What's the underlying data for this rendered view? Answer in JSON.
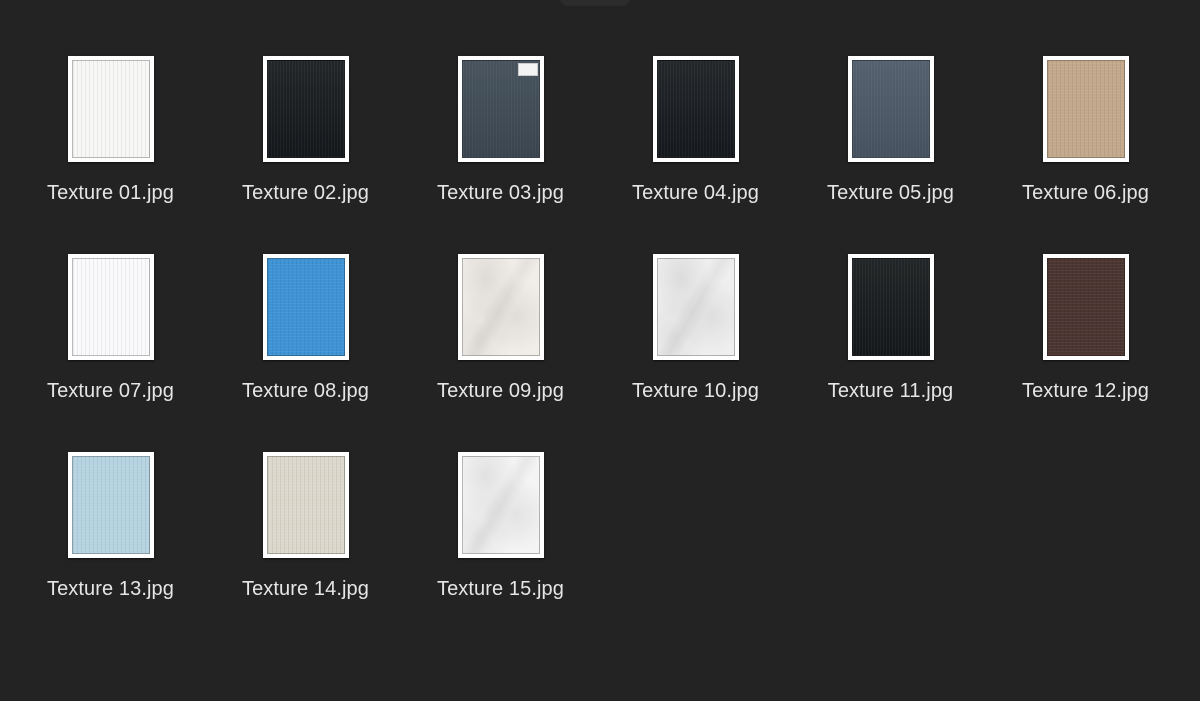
{
  "files": [
    {
      "name": "Texture 01.jpg",
      "color": "#f7f7f5",
      "texture": "linen"
    },
    {
      "name": "Texture 02.jpg",
      "color": "#161a1d",
      "texture": "denim"
    },
    {
      "name": "Texture 03.jpg",
      "color": "#3e4a55",
      "texture": "denim",
      "tag": true
    },
    {
      "name": "Texture 04.jpg",
      "color": "#171b1f",
      "texture": "denim"
    },
    {
      "name": "Texture 05.jpg",
      "color": "#4b5866",
      "texture": "denim"
    },
    {
      "name": "Texture 06.jpg",
      "color": "#c3a98c",
      "texture": "linen"
    },
    {
      "name": "Texture 07.jpg",
      "color": "#fafafc",
      "texture": "linen"
    },
    {
      "name": "Texture 08.jpg",
      "color": "#3d93d3",
      "texture": "linen"
    },
    {
      "name": "Texture 09.jpg",
      "color": "#f1ede8",
      "texture": "wrinkle"
    },
    {
      "name": "Texture 10.jpg",
      "color": "#efefef",
      "texture": "wrinkle"
    },
    {
      "name": "Texture 11.jpg",
      "color": "#161a1c",
      "texture": "denim"
    },
    {
      "name": "Texture 12.jpg",
      "color": "#4a3530",
      "texture": "linen"
    },
    {
      "name": "Texture 13.jpg",
      "color": "#b6d3e1",
      "texture": "linen"
    },
    {
      "name": "Texture 14.jpg",
      "color": "#dcd8cc",
      "texture": "linen"
    },
    {
      "name": "Texture 15.jpg",
      "color": "#f4f4f4",
      "texture": "wrinkle"
    }
  ]
}
